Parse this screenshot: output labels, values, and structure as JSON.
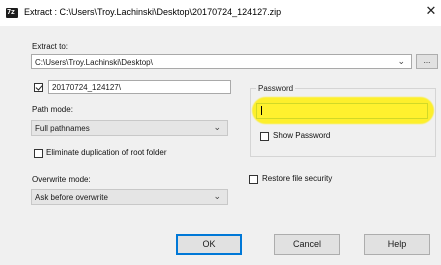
{
  "window": {
    "title": "Extract : C:\\Users\\Troy.Lachinski\\Desktop\\20170724_124127.zip",
    "close_glyph": "✕",
    "app_icon_text": "7z"
  },
  "extract_to": {
    "label": "Extract to:",
    "value": "C:\\Users\\Troy.Lachinski\\Desktop\\",
    "browse_label": "..."
  },
  "subfolder": {
    "checked": true,
    "value": "20170724_124127\\"
  },
  "path_mode": {
    "label": "Path mode:",
    "selected": "Full pathnames"
  },
  "eliminate_duplication": {
    "label": "Eliminate duplication of root folder",
    "checked": false
  },
  "overwrite_mode": {
    "label": "Overwrite mode:",
    "selected": "Ask before overwrite"
  },
  "password": {
    "group_label": "Password",
    "value": "",
    "show_password_label": "Show Password",
    "show_password_checked": false,
    "highlight_color": "#ffee00"
  },
  "restore_security": {
    "label": "Restore file security",
    "checked": false
  },
  "buttons": {
    "ok": "OK",
    "cancel": "Cancel",
    "help": "Help"
  },
  "icons": {
    "chevron": "chevron-down-icon",
    "check": "checkmark-icon"
  }
}
